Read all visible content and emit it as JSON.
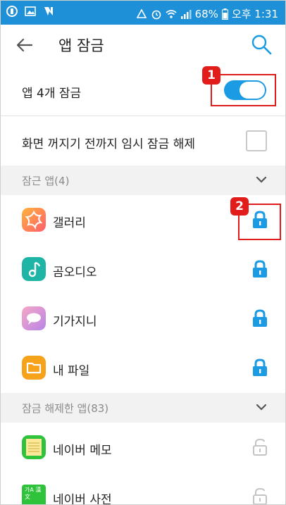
{
  "status_bar": {
    "battery": "68%",
    "time": "오후 1:31"
  },
  "app_bar": {
    "title": "앱 잠금"
  },
  "settings": {
    "lock_toggle_label": "앱 4개 잠금",
    "lock_toggle_on": true,
    "temp_unlock_label": "화면 꺼지기 전까지 임시 잠금 해제",
    "temp_unlock_checked": false
  },
  "locked_section": {
    "header": "잠근 앱(4)",
    "apps": [
      {
        "name": "갤러리",
        "icon": "gallery-icon",
        "locked": true
      },
      {
        "name": "곰오디오",
        "icon": "gomaudio-icon",
        "locked": true
      },
      {
        "name": "기가지니",
        "icon": "gigagenie-icon",
        "locked": true
      },
      {
        "name": "내 파일",
        "icon": "myfiles-icon",
        "locked": true
      }
    ]
  },
  "unlocked_section": {
    "header": "잠금 해제한 앱(83)",
    "apps": [
      {
        "name": "네이버 메모",
        "icon": "naver-memo-icon",
        "locked": false
      },
      {
        "name": "네이버 사전",
        "icon": "naver-dict-icon",
        "dict_icon_text": "가A 漢文",
        "locked": false
      }
    ]
  },
  "annotations": {
    "badge1": "1",
    "badge2": "2"
  },
  "colors": {
    "accent": "#1a9be3",
    "status_bar": "#1e90d8",
    "callout": "#e21b1b",
    "section_bg": "#f2f2f2"
  }
}
